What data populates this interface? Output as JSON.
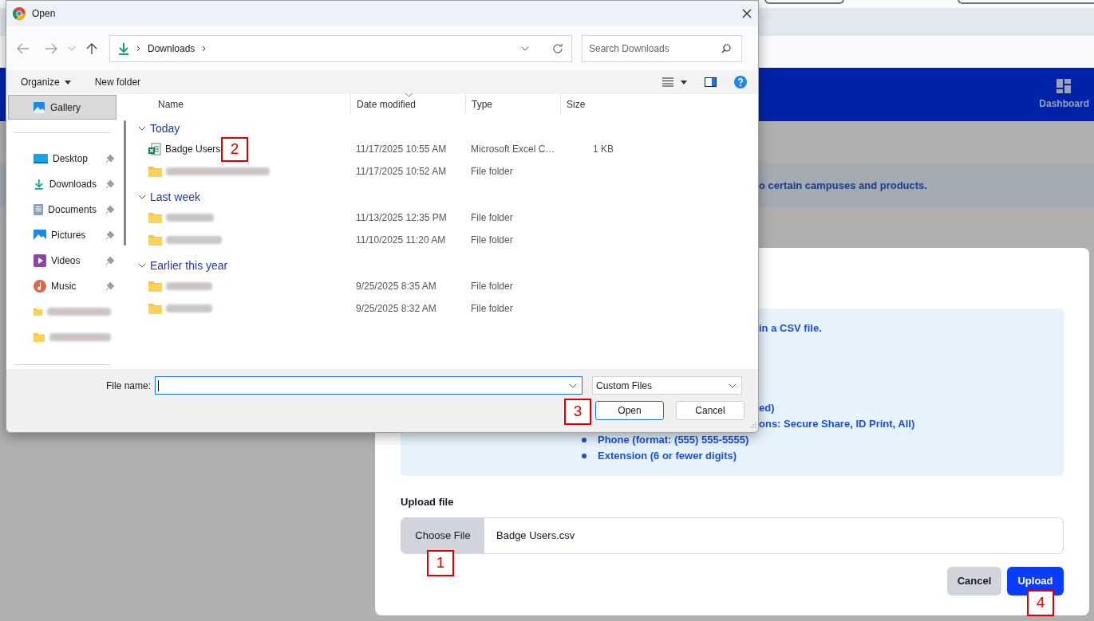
{
  "page": {
    "nav_items": [
      {
        "label": "Dashboard",
        "selected": false
      }
    ],
    "banner_text": "o certain campuses and products."
  },
  "upload_modal": {
    "info_lines": [
      "in a CSV file.",
      "ed)",
      "ons: Secure Share, ID Print, All)"
    ],
    "bullets": [
      "Phone (format: (555) 555-5555)",
      "Extension (6 or fewer digits)"
    ],
    "upload_label": "Upload file",
    "choose_button": "Choose File",
    "file_value": "Badge Users.csv",
    "buttons": [
      {
        "label": "Cancel",
        "kind": "secondary"
      },
      {
        "label": "Upload",
        "kind": "primary"
      }
    ]
  },
  "file_dialog": {
    "title": "Open",
    "path": [
      "Downloads"
    ],
    "search_placeholder": "Search Downloads",
    "toolbar": [
      "Organize",
      "New folder"
    ],
    "sidebar": [
      {
        "label": "Gallery",
        "kind": "gallery",
        "selected": true,
        "pinned": false
      },
      {
        "label": "Desktop",
        "kind": "desktop",
        "selected": false,
        "pinned": true
      },
      {
        "label": "Downloads",
        "kind": "downloads",
        "selected": false,
        "pinned": true
      },
      {
        "label": "Documents",
        "kind": "documents",
        "selected": false,
        "pinned": true
      },
      {
        "label": "Pictures",
        "kind": "pictures",
        "selected": false,
        "pinned": true
      },
      {
        "label": "Videos",
        "kind": "videos",
        "selected": false,
        "pinned": true
      },
      {
        "label": "Music",
        "kind": "music",
        "selected": false,
        "pinned": true
      },
      {
        "kind": "folder",
        "blurred": true,
        "selected": false,
        "pinned": false
      },
      {
        "kind": "folder",
        "blurred": true,
        "selected": false,
        "pinned": false
      }
    ],
    "columns": [
      "Name",
      "Date modified",
      "Type",
      "Size"
    ],
    "groups": [
      {
        "label": "Today",
        "expanded": true,
        "rows": [
          {
            "name": "Badge Users",
            "kind": "excel",
            "date": "11/17/2025 10:55 AM",
            "type": "Microsoft Excel C…",
            "size": "1 KB"
          },
          {
            "kind": "folder",
            "blurred": true,
            "date": "11/17/2025 10:52 AM",
            "type": "File folder"
          }
        ]
      },
      {
        "label": "Last week",
        "expanded": true,
        "rows": [
          {
            "kind": "folder",
            "blurred": true,
            "date": "11/13/2025 12:35 PM",
            "type": "File folder"
          },
          {
            "kind": "folder",
            "blurred": true,
            "date": "11/10/2025 11:20 AM",
            "type": "File folder"
          }
        ]
      },
      {
        "label": "Earlier this year",
        "expanded": true,
        "rows": [
          {
            "kind": "folder",
            "blurred": true,
            "date": "9/25/2025 8:35 AM",
            "type": "File folder"
          },
          {
            "kind": "folder",
            "blurred": true,
            "date": "9/25/2025 8:32 AM",
            "type": "File folder"
          }
        ]
      }
    ],
    "file_name_label": "File name:",
    "file_type": "Custom Files",
    "buttons": [
      {
        "label": "Open",
        "kind": "default"
      },
      {
        "label": "Cancel",
        "kind": "normal"
      }
    ]
  },
  "annotations": [
    "2",
    "3",
    "1",
    "4"
  ]
}
